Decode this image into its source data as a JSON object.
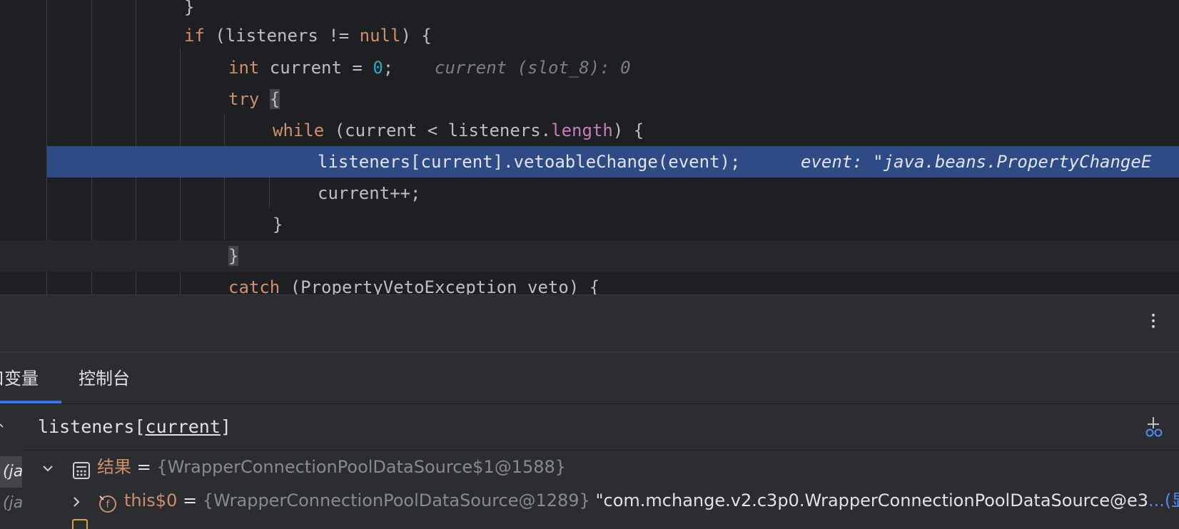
{
  "editor": {
    "lines": [
      {
        "text": "}"
      },
      {
        "kw_if": "if",
        "open": " (listeners != ",
        "kw_null": "null",
        "close": ") {"
      },
      {
        "kw_int": "int",
        "mid": " current = ",
        "num": "0",
        "end": ";",
        "hint": "current (slot_8): 0"
      },
      {
        "kw_try": "try",
        "sp": " ",
        "brace": "{"
      },
      {
        "kw_while": "while",
        "a": " (current < listeners.",
        "field": "length",
        "b": ") {"
      },
      {
        "code": "listeners[current].vetoableChange(event);",
        "hint": "event: \"java.beans.PropertyChangeE"
      },
      {
        "code": "current++;"
      },
      {
        "code": "}"
      },
      {
        "brace": "}"
      },
      {
        "kw_catch": "catch",
        "rest": " (PropertyVetoException veto) {"
      }
    ]
  },
  "tabs": [
    {
      "label": "变量",
      "prefix": "口"
    },
    {
      "label": "控制台"
    }
  ],
  "evaluate": {
    "expr_pre": "listeners[",
    "expr_var": "current",
    "expr_post": "]"
  },
  "frames": [
    {
      "label": "(ja"
    },
    {
      "label": "(ja"
    }
  ],
  "tree": [
    {
      "name": "结果",
      "eq": " = ",
      "type": "{WrapperConnectionPoolDataSource$1@1588}"
    },
    {
      "name": "this$0",
      "eq": " = ",
      "type": "{WrapperConnectionPoolDataSource@1289}",
      "value": " \"com.mchange.v2.c3p0.WrapperConnectionPoolDataSource@e3",
      "more": "...(显"
    }
  ],
  "colors": {
    "editor_bg": "#1e1f22",
    "keyword": "#cf8e6d",
    "number": "#2aacb8",
    "field": "#c77dbb",
    "execution_line": "#2e4b86",
    "accent": "#3574f0"
  }
}
